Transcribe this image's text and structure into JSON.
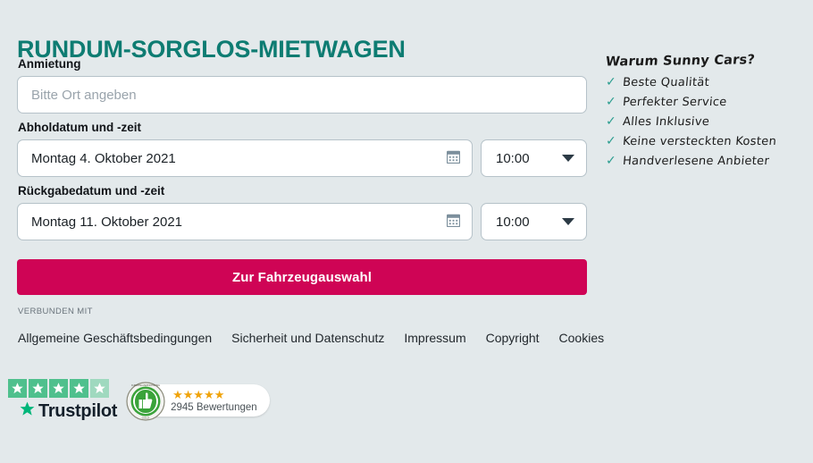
{
  "page": {
    "title": "RUNDUM-SORGLOS-MIETWAGEN",
    "background_color": "#e3e9eb",
    "title_color": "#0e7c72",
    "accent_color": "#cf0455"
  },
  "form": {
    "pickup_location": {
      "label": "Anmietung",
      "placeholder": "Bitte Ort angeben",
      "value": ""
    },
    "pickup_date": {
      "label": "Abholdatum und -zeit",
      "date_value": "Montag 4. Oktober 2021",
      "time_value": "10:00",
      "calendar_icon": "calendar-icon",
      "dropdown_icon": "chevron-down-icon"
    },
    "return_date": {
      "label": "Rückgabedatum und -zeit",
      "date_value": "Montag 11. Oktober 2021",
      "time_value": "10:00",
      "calendar_icon": "calendar-icon",
      "dropdown_icon": "chevron-down-icon"
    },
    "submit_label": "Zur Fahrzeugauswahl"
  },
  "footer": {
    "connected_label": "VERBUNDEN MIT",
    "links": [
      "Allgemeine Geschäftsbedingungen",
      "Sicherheit und Datenschutz",
      "Impressum",
      "Copyright",
      "Cookies"
    ]
  },
  "badges": {
    "trustpilot": {
      "name": "Trustpilot",
      "star_icon": "star-icon",
      "stars_filled": 4,
      "stars_half": 1,
      "star_color": "#4fc08d"
    },
    "review_seal": {
      "seal_icon": "thumbs-up-seal-icon",
      "seal_ring_text": "KUNDENAUSZEICHNUNG",
      "seal_bottom_text": "GOLD",
      "stars": "★★★★★",
      "count_text": "2945 Bewertungen",
      "star_color": "#f0a30a"
    }
  },
  "usp": {
    "title": "Warum Sunny Cars?",
    "check_icon": "check-icon",
    "check_color": "#2a9d8f",
    "items": [
      "Beste Qualität",
      "Perfekter Service",
      "Alles Inklusive",
      "Keine versteckten Kosten",
      "Handverlesene Anbieter"
    ]
  }
}
